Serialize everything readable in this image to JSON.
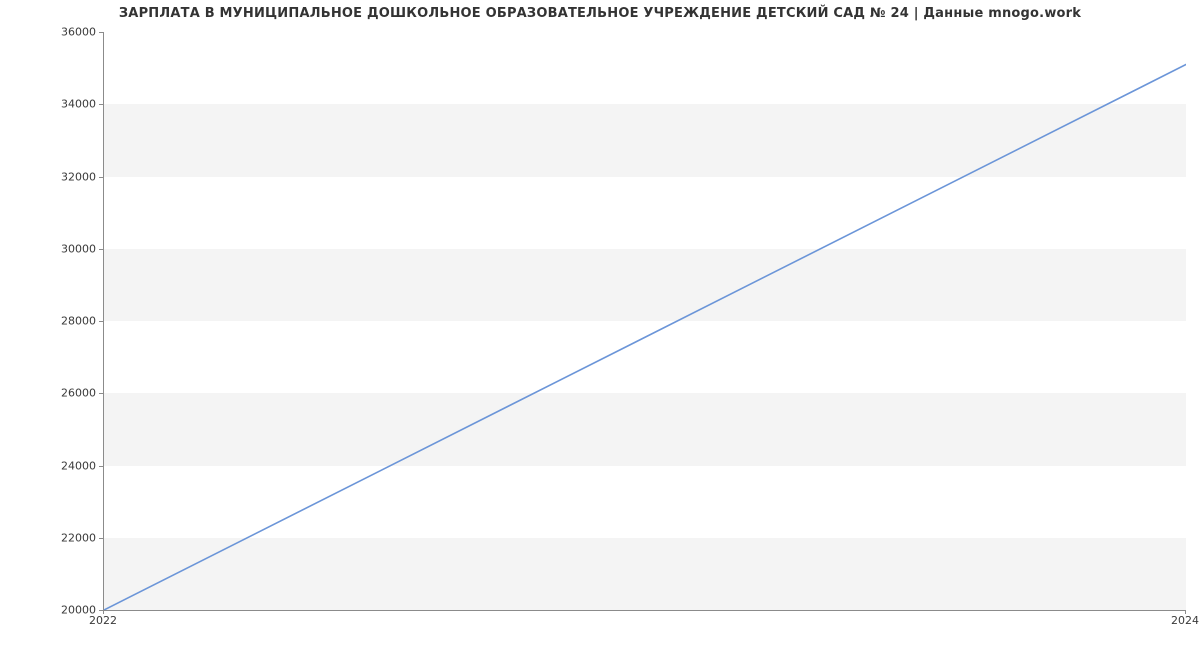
{
  "chart_data": {
    "type": "line",
    "title": "ЗАРПЛАТА В МУНИЦИПАЛЬНОЕ ДОШКОЛЬНОЕ ОБРАЗОВАТЕЛЬНОЕ УЧРЕЖДЕНИЕ ДЕТСКИЙ САД № 24 | Данные mnogo.work",
    "x": [
      2022,
      2024
    ],
    "values": [
      20000,
      35100
    ],
    "xlabel": "",
    "ylabel": "",
    "xlim": [
      2022,
      2024
    ],
    "ylim": [
      20000,
      36000
    ],
    "yticks": [
      20000,
      22000,
      24000,
      26000,
      28000,
      30000,
      32000,
      34000,
      36000
    ],
    "xticks": [
      2022,
      2024
    ],
    "line_color": "#6b95d8",
    "grid_band_color": "#f4f4f4"
  }
}
